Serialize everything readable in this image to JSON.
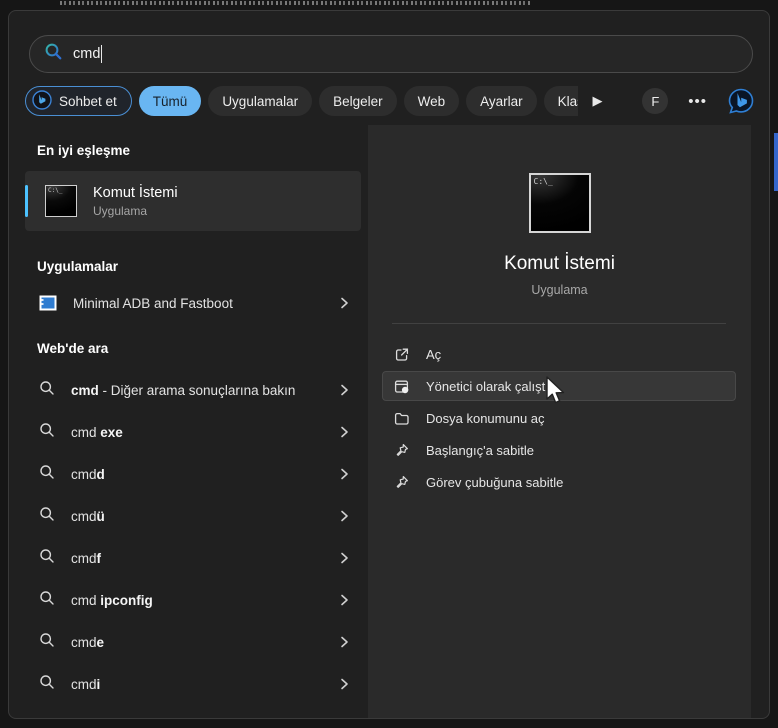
{
  "search": {
    "value": "cmd"
  },
  "filters": {
    "chat_label": "Sohbet et",
    "tabs": [
      "Tümü",
      "Uygulamalar",
      "Belgeler",
      "Web",
      "Ayarlar",
      "Klasörler"
    ],
    "active_tab": "Tümü",
    "overflow_arrow": "▶",
    "avatar_letter": "F",
    "more_label": "•••"
  },
  "left": {
    "best_match_header": "En iyi eşleşme",
    "best_match": {
      "title": "Komut İstemi",
      "subtitle": "Uygulama"
    },
    "apps_header": "Uygulamalar",
    "apps": [
      {
        "label": "Minimal ADB and Fastboot"
      }
    ],
    "web_header": "Web'de ara",
    "web_suggestions": [
      {
        "parts": [
          {
            "t": "cmd",
            "b": true
          },
          {
            "t": " - Diğer arama sonuçlarına bakın",
            "b": false
          }
        ]
      },
      {
        "parts": [
          {
            "t": "cmd ",
            "b": false
          },
          {
            "t": "exe",
            "b": true
          }
        ]
      },
      {
        "parts": [
          {
            "t": "cmd",
            "b": false
          },
          {
            "t": "d",
            "b": true
          }
        ]
      },
      {
        "parts": [
          {
            "t": "cmd",
            "b": false
          },
          {
            "t": "ü",
            "b": true
          }
        ]
      },
      {
        "parts": [
          {
            "t": "cmd",
            "b": false
          },
          {
            "t": "f",
            "b": true
          }
        ]
      },
      {
        "parts": [
          {
            "t": "cmd ",
            "b": false
          },
          {
            "t": "ipconfig",
            "b": true
          }
        ]
      },
      {
        "parts": [
          {
            "t": "cmd",
            "b": false
          },
          {
            "t": "e",
            "b": true
          }
        ]
      },
      {
        "parts": [
          {
            "t": "cmd",
            "b": false
          },
          {
            "t": "i",
            "b": true
          }
        ]
      }
    ]
  },
  "right": {
    "title": "Komut İstemi",
    "subtitle": "Uygulama",
    "actions": [
      {
        "label": "Aç",
        "icon": "open-icon",
        "highlighted": false
      },
      {
        "label": "Yönetici olarak çalıştır",
        "icon": "run-as-admin-icon",
        "highlighted": true
      },
      {
        "label": "Dosya konumunu aç",
        "icon": "folder-icon",
        "highlighted": false
      },
      {
        "label": "Başlangıç'a sabitle",
        "icon": "pin-icon",
        "highlighted": false
      },
      {
        "label": "Görev çubuğuna sabitle",
        "icon": "pin-icon",
        "highlighted": false
      }
    ]
  },
  "colors": {
    "accent": "#4cc2ff",
    "active_pill": "#69b6f2",
    "bing_blue": "#2f7fd4"
  }
}
